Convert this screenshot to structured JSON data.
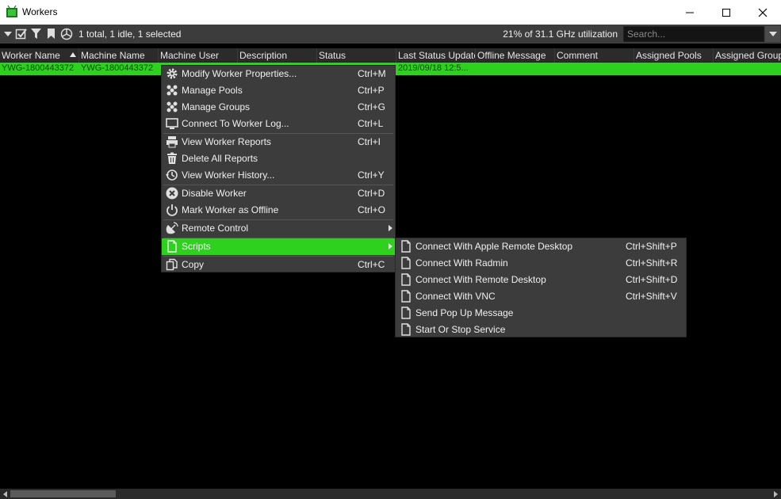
{
  "window": {
    "title": "Workers"
  },
  "toolbar": {
    "summary": "1 total, 1 idle, 1 selected",
    "utilization": "21% of 31.1 GHz utilization",
    "search_placeholder": "Search..."
  },
  "columns": [
    "Worker Name",
    "Machine Name",
    "Machine User",
    "Description",
    "Status",
    "Last Status Update",
    "Offline Message",
    "Comment",
    "Assigned Pools",
    "Assigned Groups"
  ],
  "row": {
    "worker_name": "YWG-1800443372",
    "machine_name": "YWG-1800443372",
    "last_status_update": "2019/09/18 12:5..."
  },
  "context_menu": {
    "items": [
      {
        "label": "Modify Worker Properties...",
        "shortcut": "Ctrl+M",
        "icon": "gear-icon"
      },
      {
        "label": "Manage Pools",
        "shortcut": "Ctrl+P",
        "icon": "cluster-icon"
      },
      {
        "label": "Manage Groups",
        "shortcut": "Ctrl+G",
        "icon": "cluster-icon"
      },
      {
        "label": "Connect To Worker Log...",
        "shortcut": "Ctrl+L",
        "icon": "monitor-icon"
      },
      {
        "label": "View Worker Reports",
        "shortcut": "Ctrl+I",
        "icon": "printer-icon"
      },
      {
        "label": "Delete All Reports",
        "shortcut": "",
        "icon": "trash-icon"
      },
      {
        "label": "View Worker History...",
        "shortcut": "Ctrl+Y",
        "icon": "history-icon"
      },
      {
        "label": "Disable Worker",
        "shortcut": "Ctrl+D",
        "icon": "x-circle-icon"
      },
      {
        "label": "Mark Worker as Offline",
        "shortcut": "Ctrl+O",
        "icon": "power-icon"
      },
      {
        "label": "Remote Control",
        "shortcut": "",
        "icon": "satellite-icon"
      },
      {
        "label": "Scripts",
        "shortcut": "",
        "icon": "document-icon"
      },
      {
        "label": "Copy",
        "shortcut": "Ctrl+C",
        "icon": "copy-icon"
      }
    ]
  },
  "scripts_submenu": {
    "items": [
      {
        "label": "Connect With Apple Remote Desktop",
        "shortcut": "Ctrl+Shift+P"
      },
      {
        "label": "Connect With Radmin",
        "shortcut": "Ctrl+Shift+R"
      },
      {
        "label": "Connect With Remote Desktop",
        "shortcut": "Ctrl+Shift+D"
      },
      {
        "label": "Connect With VNC",
        "shortcut": "Ctrl+Shift+V"
      },
      {
        "label": "Send Pop Up Message",
        "shortcut": ""
      },
      {
        "label": "Start Or Stop Service",
        "shortcut": ""
      }
    ]
  },
  "colors": {
    "accent": "#2ed11e",
    "menu_bg": "#3c3c3c",
    "background": "#000000"
  }
}
